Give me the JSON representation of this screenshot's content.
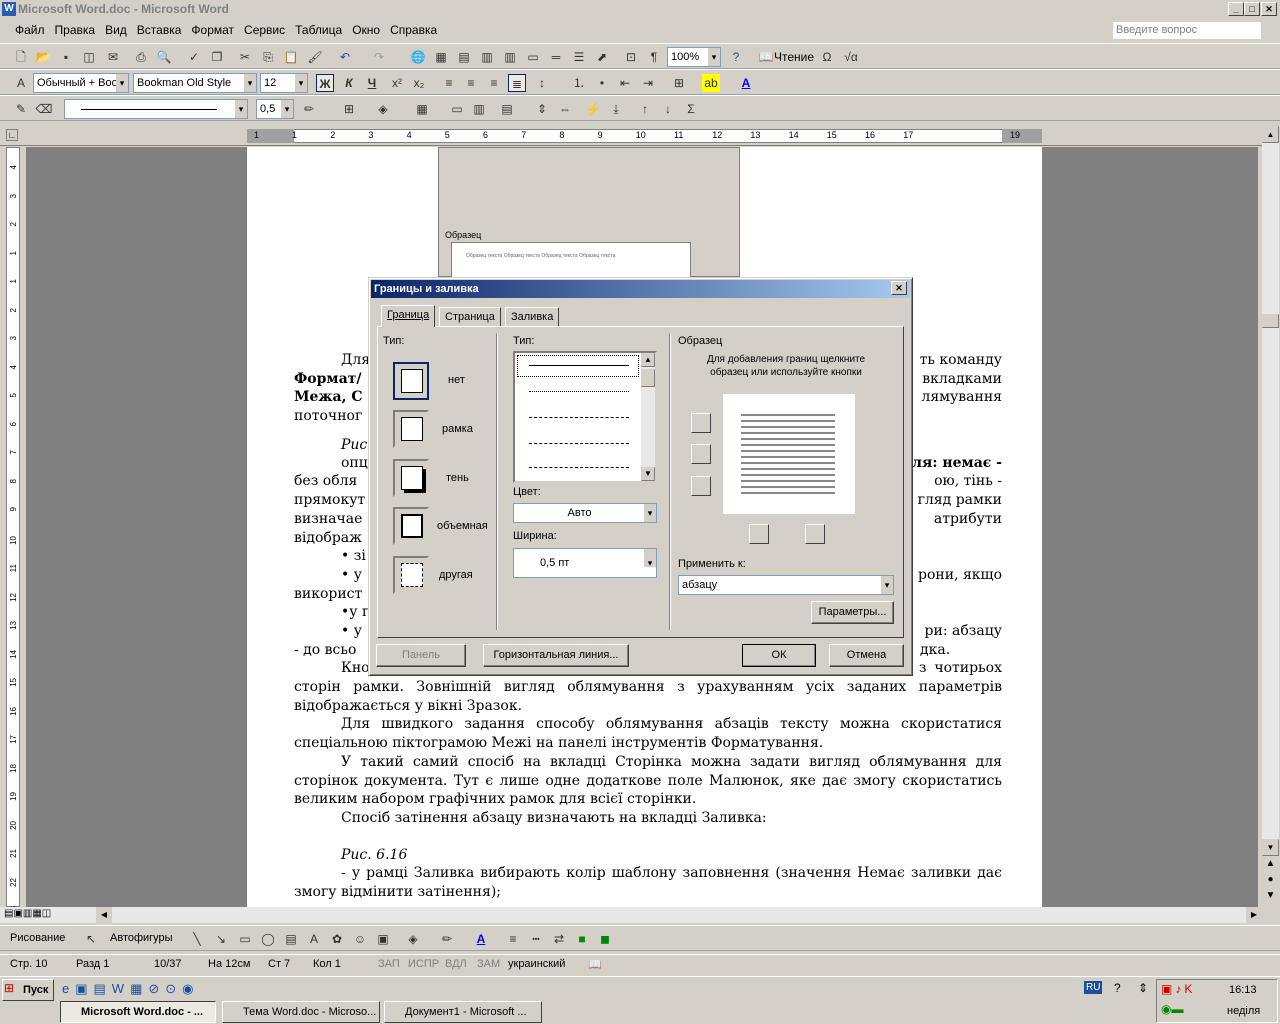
{
  "window": {
    "title": "Microsoft Word.doc - Microsoft Word",
    "ask": "Введите вопрос"
  },
  "menu": [
    "Файл",
    "Правка",
    "Вид",
    "Вставка",
    "Формат",
    "Сервис",
    "Таблица",
    "Окно",
    "Справка"
  ],
  "toolbar": {
    "zoom": "100%",
    "read": "Чтение",
    "style": "Обычный + Boo",
    "font": "Bookman Old Style",
    "size": "12",
    "bold": "Ж",
    "italic": "К",
    "underline": "Ч",
    "line_weight": "0,5"
  },
  "ruler": {
    "h_ticks": [
      "1",
      "1",
      "2",
      "3",
      "4",
      "5",
      "6",
      "7",
      "8",
      "9",
      "10",
      "11",
      "12",
      "13",
      "14",
      "15",
      "16",
      "17",
      "19"
    ],
    "v_ticks": [
      "4",
      "3",
      "2",
      "1",
      "1",
      "2",
      "3",
      "4",
      "5",
      "6",
      "7",
      "8",
      "9",
      "10",
      "11",
      "12",
      "13",
      "14",
      "15",
      "16",
      "17",
      "18",
      "19",
      "20",
      "21",
      "22",
      "23"
    ]
  },
  "bg_dialog": {
    "label": "Образец",
    "sample": "Образец текста Образец текста Образец текста Образец текста"
  },
  "document": {
    "frag1": [
      "Для",
      "ть команду"
    ],
    "frag2": [
      "Формат/",
      "вкладками"
    ],
    "frag3": [
      "Межа, С",
      "лямування"
    ],
    "frag4": [
      "поточног"
    ],
    "fig1": "Рис",
    "frag5": [
      "опц",
      "ля: немає -"
    ],
    "frag6": [
      "без обля",
      "ою, тінь -"
    ],
    "frag7": [
      "прямокут",
      "гляд рамки"
    ],
    "frag8": [
      "визначае",
      "атрибути"
    ],
    "frag9": [
      "відображ"
    ],
    "b1": "• зі",
    "b2": [
      "• у",
      "рони, якщо"
    ],
    "b2b": "використ",
    "b3": "•у г",
    "b4": [
      "• у",
      "ри: абзацу"
    ],
    "b4b": [
      "- до всьо",
      "дка."
    ],
    "p1": "Кнопка Параметри призначена для зміни відстанеі від тексту до кожної з чотирьох сторін рамки. Зовнішній вигляд облямування з урахуванням усіх заданих параметрів відображається у вікні Зразок.",
    "p2": "Для швидкого задання способу облямування абзаців тексту можна скористатися спеціальною піктограмою Межі на панелі інструментів Форматування.",
    "p3": "У такий самий спосіб на вкладці Сторінка можна задати вигляд облямування для сторінок документа. Тут є лише одне додаткове поле Малюнок, яке дає змогу скористатись великим набором графічних рамок для всієї сторінки.",
    "p4": "Спосіб затінення абзацу визначають на вкладці Заливка:",
    "fig2": "Рис. 6.16",
    "p5": "- у рамці Заливка вибирають колір шаблону заповнення (значення Немає заливки дає змогу відмінити затінення);"
  },
  "dialog": {
    "title": "Границы и заливка",
    "tabs": [
      "Граница",
      "Страница",
      "Заливка"
    ],
    "type_label": "Тип:",
    "types": [
      "нет",
      "рамка",
      "тень",
      "объемная",
      "другая"
    ],
    "style_label": "Тип:",
    "color_label": "Цвет:",
    "color": "Авто",
    "width_label": "Ширина:",
    "width": "0,5 пт",
    "sample_label": "Образец",
    "sample_hint": "Для добавления границ щелкните образец или используйте кнопки",
    "apply_label": "Применить к:",
    "apply": "абзацу",
    "params": "Параметры...",
    "panel": "Панель",
    "hline": "Горизонтальная линия...",
    "ok": "ОК",
    "cancel": "Отмена"
  },
  "drawing": {
    "draw": "Рисование",
    "autoshapes": "Автофигуры"
  },
  "status": {
    "page": "Стр. 10",
    "section": "Разд 1",
    "pages": "10/37",
    "at": "На 12см",
    "line": "Ст 7",
    "col": "Кол 1",
    "rec": "ЗАП",
    "trk": "ИСПР",
    "ext": "ВДЛ",
    "ovr": "ЗАМ",
    "lang": "украинский"
  },
  "taskbar": {
    "start": "Пуск",
    "tasks": [
      "Microsoft Word.doc - ...",
      "Тема Word.doc - Microso...",
      "Документ1 - Microsoft ..."
    ],
    "lang": "RU",
    "time": "16:13",
    "day": "неділя"
  },
  "colors": {
    "title_active": "#0a246a",
    "title_grad": "#a6caf0",
    "workspace": "#808080"
  }
}
